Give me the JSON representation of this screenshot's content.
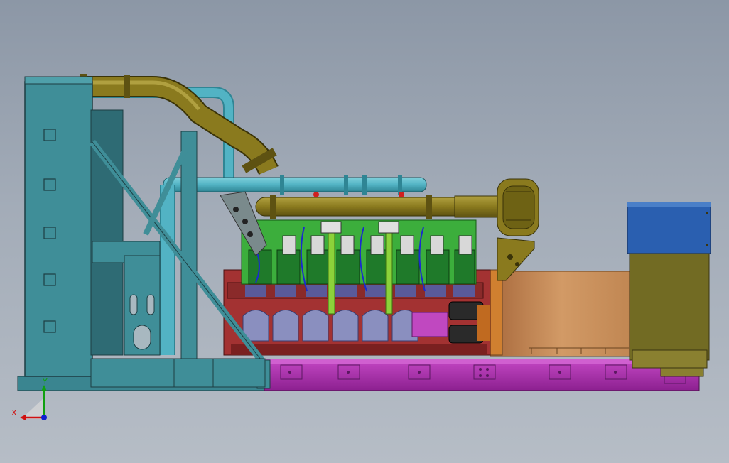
{
  "viewport": {
    "background_top": "#8c97a6",
    "background_bottom": "#b6bdc6"
  },
  "model": {
    "name": "generator-set-assembly",
    "components": [
      "radiator-frame",
      "exhaust-pipe-upper",
      "exhaust-pipe-lower",
      "coolant-pipe",
      "engine-block",
      "cylinder-heads",
      "turbocharger",
      "alternator",
      "control-box",
      "base-skid"
    ],
    "colors": {
      "frame": "#3f8e98",
      "frame_dark": "#2e6b74",
      "exhaust": "#8a7a1e",
      "coolant_pipe": "#52b3c4",
      "engine_green": "#3cae3c",
      "engine_block": "#a33232",
      "crankcase_panel": "#8a8fbf",
      "skid": "#b22fb2",
      "alternator": "#c88a55",
      "control_box": "#726b23",
      "control_box_top": "#2a5fb0",
      "green_pipe": "#8cd23a"
    }
  },
  "axis_triad": {
    "x_label": "X",
    "y_label": "Y",
    "x_color": "#d01010",
    "y_color": "#10a010",
    "z_color": "#1020d0"
  }
}
